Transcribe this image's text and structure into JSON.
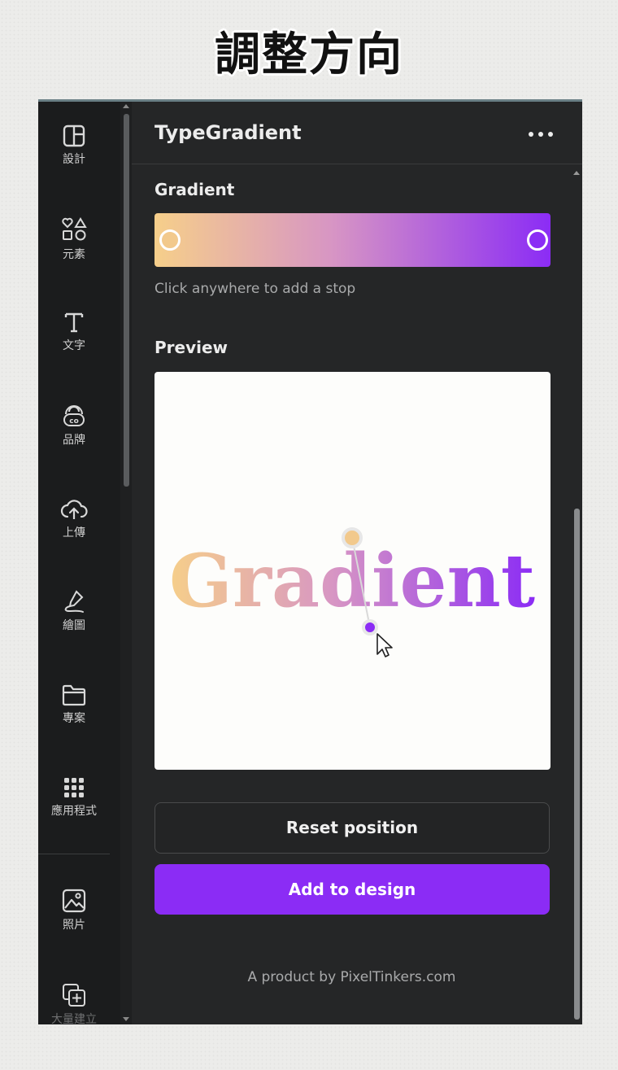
{
  "caption": "調整方向",
  "sidebar": {
    "items": [
      {
        "icon": "layout-icon",
        "label": "設計"
      },
      {
        "icon": "elements-icon",
        "label": "元素"
      },
      {
        "icon": "text-icon",
        "label": "文字"
      },
      {
        "icon": "brand-icon",
        "label": "品牌"
      },
      {
        "icon": "upload-cloud-icon",
        "label": "上傳"
      },
      {
        "icon": "draw-icon",
        "label": "繪圖"
      },
      {
        "icon": "folder-icon",
        "label": "專案"
      },
      {
        "icon": "apps-grid-icon",
        "label": "應用程式"
      },
      {
        "icon": "image-icon",
        "label": "照片"
      },
      {
        "icon": "add-copy-icon",
        "label": "大量建立"
      }
    ]
  },
  "panel": {
    "title": "TypeGradient",
    "gradient_label": "Gradient",
    "gradient": {
      "start_color": "#f6cf8a",
      "mid_color": "#d795c4",
      "end_color": "#8b2cf5"
    },
    "hint": "Click anywhere to add a stop",
    "preview_label": "Preview",
    "preview_text": "Gradient",
    "reset_label": "Reset position",
    "add_label": "Add to design",
    "footer": "A product by PixelTinkers.com"
  },
  "colors": {
    "accent": "#8b2cf5",
    "panel_bg": "#252627",
    "sidebar_bg": "#1b1c1d"
  }
}
